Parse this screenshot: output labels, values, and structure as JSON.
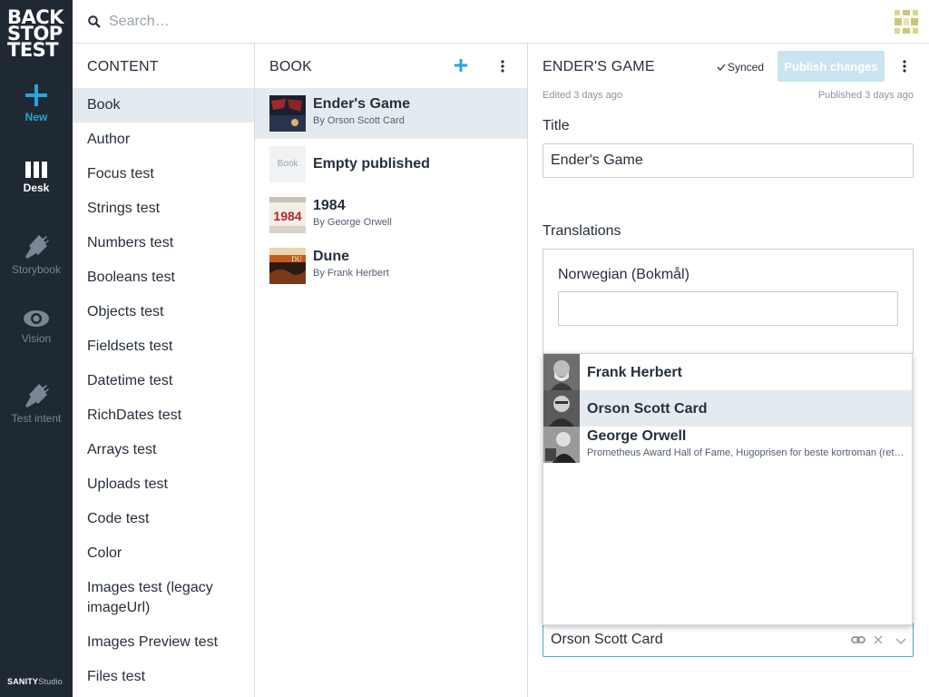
{
  "app": {
    "brand_line1": "BACK",
    "brand_line2": "STOP",
    "brand_line3": "TEST",
    "footer_brand": "SANITY",
    "footer_product": "Studio"
  },
  "tools": [
    {
      "label": "New",
      "icon": "plus-icon"
    },
    {
      "label": "Desk",
      "icon": "columns-icon"
    },
    {
      "label": "Storybook",
      "icon": "plug-icon"
    },
    {
      "label": "Vision",
      "icon": "eye-icon"
    },
    {
      "label": "Test intent",
      "icon": "plug-icon"
    }
  ],
  "search": {
    "placeholder": "Search…"
  },
  "content_pane": {
    "title": "CONTENT",
    "items": [
      {
        "label": "Book"
      },
      {
        "label": "Author"
      },
      {
        "label": "Focus test"
      },
      {
        "label": "Strings test"
      },
      {
        "label": "Numbers test"
      },
      {
        "label": "Booleans test"
      },
      {
        "label": "Objects test"
      },
      {
        "label": "Fieldsets test"
      },
      {
        "label": "Datetime test"
      },
      {
        "label": "RichDates test"
      },
      {
        "label": "Arrays test"
      },
      {
        "label": "Uploads test"
      },
      {
        "label": "Code test"
      },
      {
        "label": "Color"
      },
      {
        "label": "Images test (legacy imageUrl)"
      },
      {
        "label": "Images Preview test"
      },
      {
        "label": "Files test"
      }
    ]
  },
  "book_pane": {
    "title": "BOOK",
    "docs": [
      {
        "title": "Ender's Game",
        "subtitle": "By Orson Scott Card"
      },
      {
        "title": "Empty published",
        "subtitle": "",
        "thumb_text": "Book"
      },
      {
        "title": "1984",
        "subtitle": "By George Orwell",
        "thumb_text": "1984"
      },
      {
        "title": "Dune",
        "subtitle": "By Frank Herbert",
        "thumb_text": "DU"
      }
    ]
  },
  "editor": {
    "title": "ENDER'S GAME",
    "synced": "Synced",
    "publish_label": "Publish changes",
    "edited": "Edited 3 days ago",
    "published": "Published 3 days ago",
    "title_label": "Title",
    "title_value": "Ender's Game",
    "translations_label": "Translations",
    "norwegian_label": "Norwegian (Bokmål)",
    "norwegian_value": "",
    "author_value": "Orson Scott Card"
  },
  "author_options": [
    {
      "name": "Frank Herbert",
      "description": ""
    },
    {
      "name": "Orson Scott Card",
      "description": ""
    },
    {
      "name": "George Orwell",
      "description": "Prometheus Award Hall of Fame, Hugoprisen for beste kortroman (ret…"
    }
  ],
  "colors": {
    "sidebar_bg": "#1f2933",
    "accent": "#2ba3db",
    "selected_bg": "#e4ebf0",
    "publish_disabled": "#c9e4ee"
  }
}
